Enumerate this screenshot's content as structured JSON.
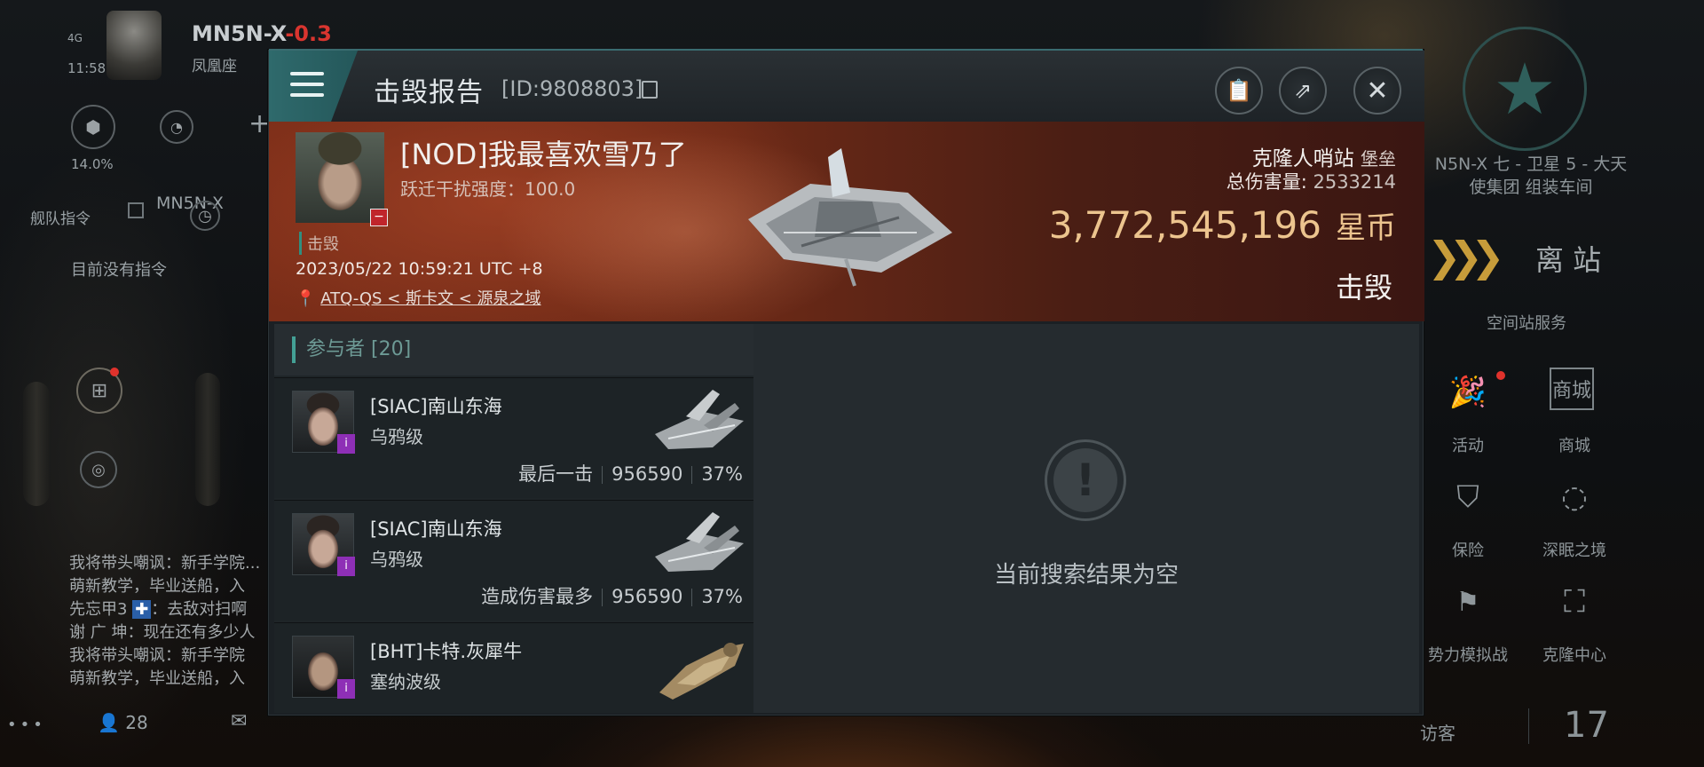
{
  "hud_left": {
    "system_name": "MN5N-X",
    "security": "-0.3",
    "region_text": "凤凰座",
    "signal": "4G",
    "time": "11:58",
    "cargo_percent": "14.0%",
    "fleet_cmd_label": "舰队指令",
    "fleet_target": "MN5N-X",
    "no_command": "目前没有指令",
    "chat": [
      {
        "user": "我将带头嘲讽",
        "text": "新手学院..."
      },
      {
        "user": "",
        "text": "萌新教学，毕业送船，入"
      },
      {
        "user": "先忘甲3",
        "text": "去敌对扫啊"
      },
      {
        "user": "谢 广 坤",
        "text": "现在还有多少人"
      },
      {
        "user": "我将带头嘲讽",
        "text": "新手学院"
      },
      {
        "user": "",
        "text": "萌新教学，毕业送船，入"
      }
    ],
    "online_count": "28"
  },
  "hud_right": {
    "location_line1": "N5N-X 七 - 卫星 5 - 大天",
    "location_line2": "使集团 组装车间",
    "undock_label": "离 站",
    "services_label": "空间站服务",
    "services": [
      {
        "icon": "party-popper-icon",
        "label": "活动"
      },
      {
        "icon": "store-icon",
        "label": "商城"
      },
      {
        "icon": "insurance-shield-icon",
        "label": "保险"
      },
      {
        "icon": "abyss-icon",
        "label": "深眠之境"
      },
      {
        "icon": "crossed-flags-icon",
        "label": "势力模拟战"
      },
      {
        "icon": "clone-center-icon",
        "label": "克隆中心"
      }
    ],
    "visitors_label": "访客",
    "visitors_count": "17"
  },
  "dialog": {
    "title": "击毁报告",
    "id_text": "[ID:9808803]",
    "victim": {
      "name": "[NOD]我最喜欢雪乃了",
      "interference": "跃迁干扰强度：100.0",
      "status_tag": "击毁",
      "datetime": "2023/05/22 10:59:21 UTC +8",
      "location_system": "ATQ-QS",
      "location_rest": " < 斯卡文 < 源泉之域"
    },
    "structure": {
      "name": "克隆人哨站",
      "type": "堡垒"
    },
    "total_damage_label": "总伤害量:",
    "total_damage": "2533214",
    "isk_value": "3,772,545,196",
    "currency": "星币",
    "result_label": "击毁",
    "participants_label": "参与者",
    "participants_count": "[20]",
    "participants": [
      {
        "name": "[SIAC]南山东海",
        "ship": "乌鸦级",
        "role": "最后一击",
        "damage": "956590",
        "percent": "37%"
      },
      {
        "name": "[SIAC]南山东海",
        "ship": "乌鸦级",
        "role": "造成伤害最多",
        "damage": "956590",
        "percent": "37%"
      },
      {
        "name": "[BHT]卡特.灰犀牛",
        "ship": "塞纳波级",
        "role": "",
        "damage": "",
        "percent": ""
      }
    ],
    "empty_text": "当前搜索结果为空"
  }
}
